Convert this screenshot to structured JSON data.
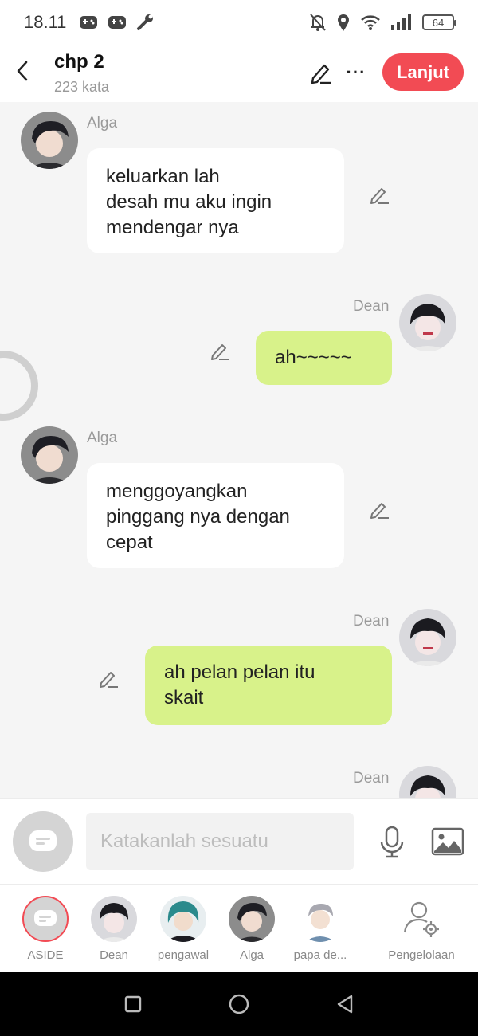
{
  "status_bar": {
    "time": "18.11",
    "left_icons": [
      "game-controller-icon",
      "game-controller-icon",
      "wrench-icon"
    ],
    "right_icons": [
      "bell-off-icon",
      "location-icon",
      "wifi-icon",
      "signal-icon"
    ],
    "battery": "64"
  },
  "header": {
    "title": "chp 2",
    "subtitle": "223 kata",
    "next_label": "Lanjut",
    "more_label": "···"
  },
  "messages": [
    {
      "side": "left",
      "speaker": "Alga",
      "text": "keluarkan lah\ndesah mu aku ingin\nmendengar nya"
    },
    {
      "side": "right",
      "speaker": "Dean",
      "text": "ah~~~~~"
    },
    {
      "side": "left",
      "speaker": "Alga",
      "text": "menggoyangkan\npinggang nya dengan\ncepat"
    },
    {
      "side": "right",
      "speaker": "Dean",
      "text": "ah pelan pelan itu\nskait"
    },
    {
      "side": "right",
      "speaker": "Dean",
      "text": ""
    }
  ],
  "composer": {
    "placeholder": "Katakanlah sesuatu",
    "value": ""
  },
  "characters": [
    {
      "label": "ASIDE"
    },
    {
      "label": "Dean"
    },
    {
      "label": "pengawal"
    },
    {
      "label": "Alga"
    },
    {
      "label": "papa de..."
    },
    {
      "label": "Pengelolaan"
    }
  ],
  "colors": {
    "accent": "#f24b54",
    "right_bubble": "#d8f28a",
    "left_bubble": "#ffffff",
    "background": "#f5f5f5"
  }
}
